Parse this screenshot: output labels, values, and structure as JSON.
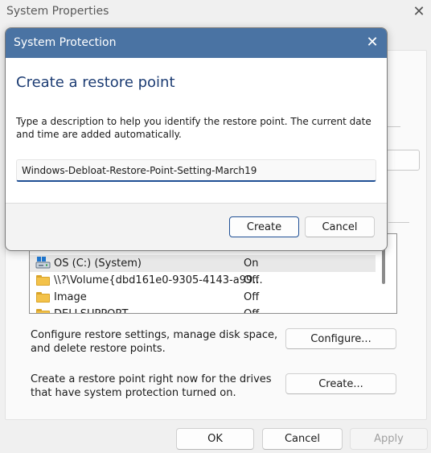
{
  "parent_window": {
    "title": "System Properties",
    "drives": [
      {
        "name": "OS (C:) (System)",
        "protection": "On",
        "icon": "drive-icon",
        "selected": true
      },
      {
        "name": "\\\\?\\Volume{dbd161e0-9305-4143-a99...",
        "protection": "Off",
        "icon": "folder-icon",
        "selected": false
      },
      {
        "name": "Image",
        "protection": "Off",
        "icon": "folder-icon",
        "selected": false
      },
      {
        "name": "DELLSUPPORT",
        "protection": "Off",
        "icon": "folder-icon",
        "selected": false
      }
    ],
    "configure_text": "Configure restore settings, manage disk space, and delete restore points.",
    "configure_button": "Configure...",
    "create_text": "Create a restore point right now for the drives that have system protection turned on.",
    "create_button": "Create...",
    "ok_button": "OK",
    "cancel_button": "Cancel",
    "apply_button": "Apply"
  },
  "dialog": {
    "title": "System Protection",
    "heading": "Create a restore point",
    "description": "Type a description to help you identify the restore point. The current date and time are added automatically.",
    "input_value": "Windows-Debloat-Restore-Point-Setting-March19",
    "create_button": "Create",
    "cancel_button": "Cancel"
  },
  "colors": {
    "titlebar": "#4a73a3",
    "heading": "#1c3c73",
    "focus_accent": "#1f4f95"
  }
}
